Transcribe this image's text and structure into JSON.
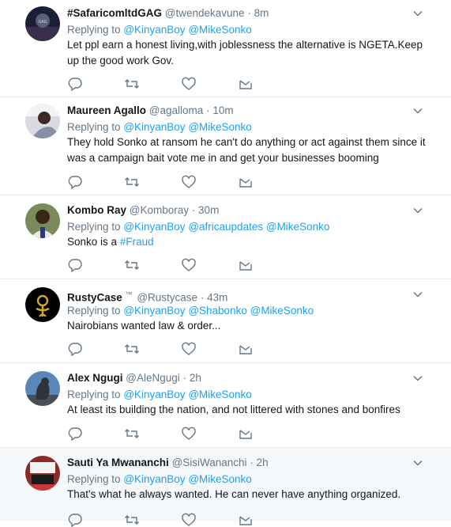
{
  "tweets": [
    {
      "name": "#SafaricomltdGAG",
      "handle": "@twendekavune",
      "time": "8m",
      "replying_label": "Replying to",
      "mentions": [
        "@KinyanBoy",
        "@MikeSonko"
      ],
      "text": "Let ppl earn a honest living,with joblessness the alternative is NGETA.Keep up the good work Gov."
    },
    {
      "name": "Maureen Agallo",
      "handle": "@agalloma",
      "time": "10m",
      "replying_label": "Replying to",
      "mentions": [
        "@KinyanBoy",
        "@MikeSonko"
      ],
      "text": "They hold Sonko at ransom he can't do anything or act against them since it was a campaign bait vote me in and get your businesses booming"
    },
    {
      "name": "Kombo Ray",
      "handle": "@Komboray",
      "time": "30m",
      "replying_label": "Replying to",
      "mentions": [
        "@KinyanBoy",
        "@africaupdates",
        "@MikeSonko"
      ],
      "text_prefix": "Sonko is a",
      "hashtag": "#Fraud"
    },
    {
      "name": "RustyCase",
      "name_suffix": "™",
      "handle": "@Rustycase",
      "time": "43m",
      "replying_label": "Replying to",
      "mentions": [
        "@KinyanBoy",
        "@Shabonko",
        "@MikeSonko"
      ],
      "text": "Nairobians wanted law & order..."
    },
    {
      "name": "Alex Ngugi",
      "handle": "@AleNgugi",
      "time": "2h",
      "replying_label": "Replying to",
      "mentions": [
        "@KinyanBoy",
        "@MikeSonko"
      ],
      "text": "At least its building the nation, and not littered with stones and bonfires"
    },
    {
      "name": "Sauti Ya Mwananchi",
      "handle": "@SisiWananchi",
      "time": "2h",
      "replying_label": "Replying to",
      "mentions": [
        "@KinyanBoy",
        "@MikeSonko"
      ],
      "text": "That's what he always wanted. He can never have anything organized."
    }
  ],
  "icons": {
    "reply": "reply-icon",
    "retweet": "retweet-icon",
    "like": "heart-icon",
    "dm": "envelope-icon",
    "more": "chevron-down-icon"
  },
  "colors": {
    "link": "#1da1f2",
    "muted": "#657786",
    "divider": "#e6ecf0",
    "highlight_bg": "#f5f8fa"
  }
}
